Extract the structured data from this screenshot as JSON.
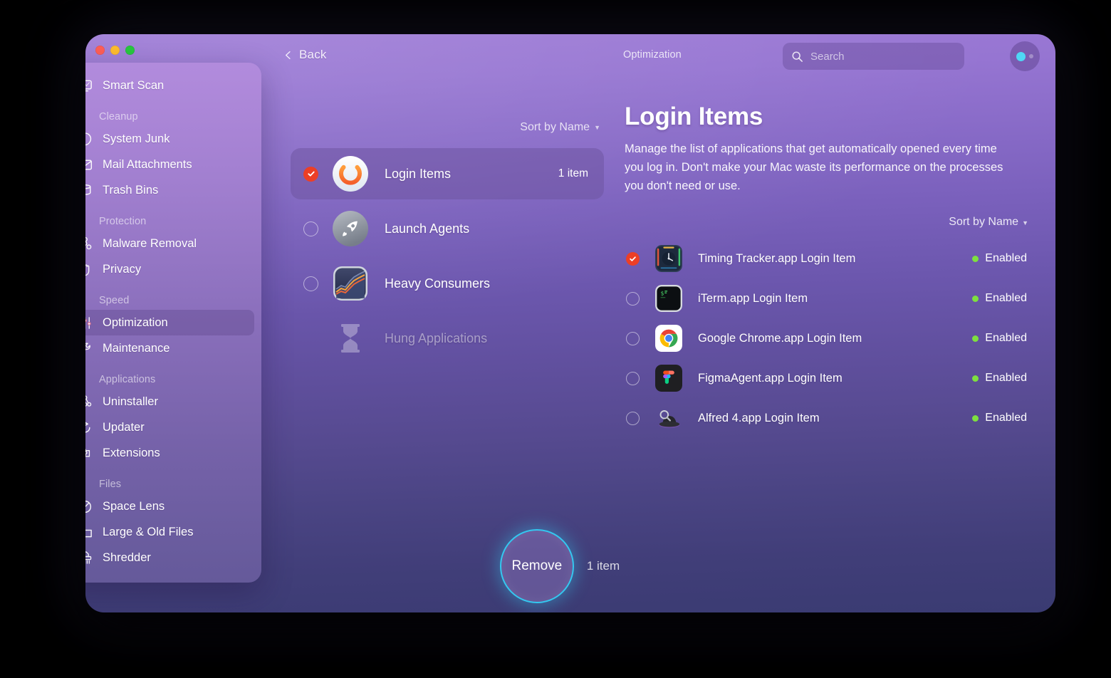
{
  "window": {
    "traffic_lights": [
      "close",
      "minimize",
      "maximize"
    ],
    "back_label": "Back",
    "section_label": "Optimization"
  },
  "search": {
    "placeholder": "Search",
    "value": "",
    "icon": "search-icon"
  },
  "account": {
    "icon": "account-status-icon",
    "status_color": "#4fd7f5"
  },
  "sidebar": {
    "top_item": {
      "label": "Smart Scan",
      "icon": "monitor-scan-icon",
      "selected": false
    },
    "groups": [
      {
        "label": "Cleanup",
        "items": [
          {
            "label": "System Junk",
            "icon": "system-junk-icon",
            "selected": false
          },
          {
            "label": "Mail Attachments",
            "icon": "mail-icon",
            "selected": false
          },
          {
            "label": "Trash Bins",
            "icon": "trash-bin-icon",
            "selected": false
          }
        ]
      },
      {
        "label": "Protection",
        "items": [
          {
            "label": "Malware Removal",
            "icon": "biohazard-icon",
            "selected": false
          },
          {
            "label": "Privacy",
            "icon": "hand-icon",
            "selected": false
          }
        ]
      },
      {
        "label": "Speed",
        "items": [
          {
            "label": "Optimization",
            "icon": "sliders-icon",
            "selected": true
          },
          {
            "label": "Maintenance",
            "icon": "wrench-icon",
            "selected": false
          }
        ]
      },
      {
        "label": "Applications",
        "items": [
          {
            "label": "Uninstaller",
            "icon": "uninstaller-icon",
            "selected": false
          },
          {
            "label": "Updater",
            "icon": "updater-icon",
            "selected": false
          },
          {
            "label": "Extensions",
            "icon": "extensions-icon",
            "selected": false
          }
        ]
      },
      {
        "label": "Files",
        "items": [
          {
            "label": "Space Lens",
            "icon": "space-lens-icon",
            "selected": false
          },
          {
            "label": "Large & Old Files",
            "icon": "folder-icon",
            "selected": false
          },
          {
            "label": "Shredder",
            "icon": "shredder-icon",
            "selected": false
          }
        ]
      }
    ]
  },
  "middle": {
    "sort_label": "Sort by Name",
    "categories": [
      {
        "name": "Login Items",
        "icon": "power-button-icon",
        "count": "1 item",
        "state": "checked",
        "selected": true,
        "disabled": false
      },
      {
        "name": "Launch Agents",
        "icon": "rocket-icon",
        "count": "",
        "state": "unchecked",
        "selected": false,
        "disabled": false
      },
      {
        "name": "Heavy Consumers",
        "icon": "activity-monitor-icon",
        "count": "",
        "state": "unchecked",
        "selected": false,
        "disabled": false
      },
      {
        "name": "Hung Applications",
        "icon": "hourglass-icon",
        "count": "",
        "state": "none",
        "selected": false,
        "disabled": true
      }
    ]
  },
  "detail": {
    "title": "Login Items",
    "description": "Manage the list of applications that get automatically opened every time you log in. Don't make your Mac waste its performance on the processes you don't need or use.",
    "sort_label": "Sort by Name",
    "items": [
      {
        "name": "Timing Tracker.app Login Item",
        "icon": "timing-tracker-app-icon",
        "status": "Enabled",
        "checked": true
      },
      {
        "name": "iTerm.app Login Item",
        "icon": "iterm-app-icon",
        "status": "Enabled",
        "checked": false
      },
      {
        "name": "Google Chrome.app Login Item",
        "icon": "google-chrome-app-icon",
        "status": "Enabled",
        "checked": false
      },
      {
        "name": "FigmaAgent.app Login Item",
        "icon": "figma-app-icon",
        "status": "Enabled",
        "checked": false
      },
      {
        "name": "Alfred 4.app Login Item",
        "icon": "alfred-app-icon",
        "status": "Enabled",
        "checked": false
      }
    ]
  },
  "bottom": {
    "action_label": "Remove",
    "count_label": "1 item",
    "accent_color": "#34c8f0"
  },
  "colors": {
    "checkbox_checked": "#ec3f26",
    "status_enabled": "#7ee03f",
    "window_top": "#9d7ad6",
    "window_bottom": "#3a3b72"
  }
}
